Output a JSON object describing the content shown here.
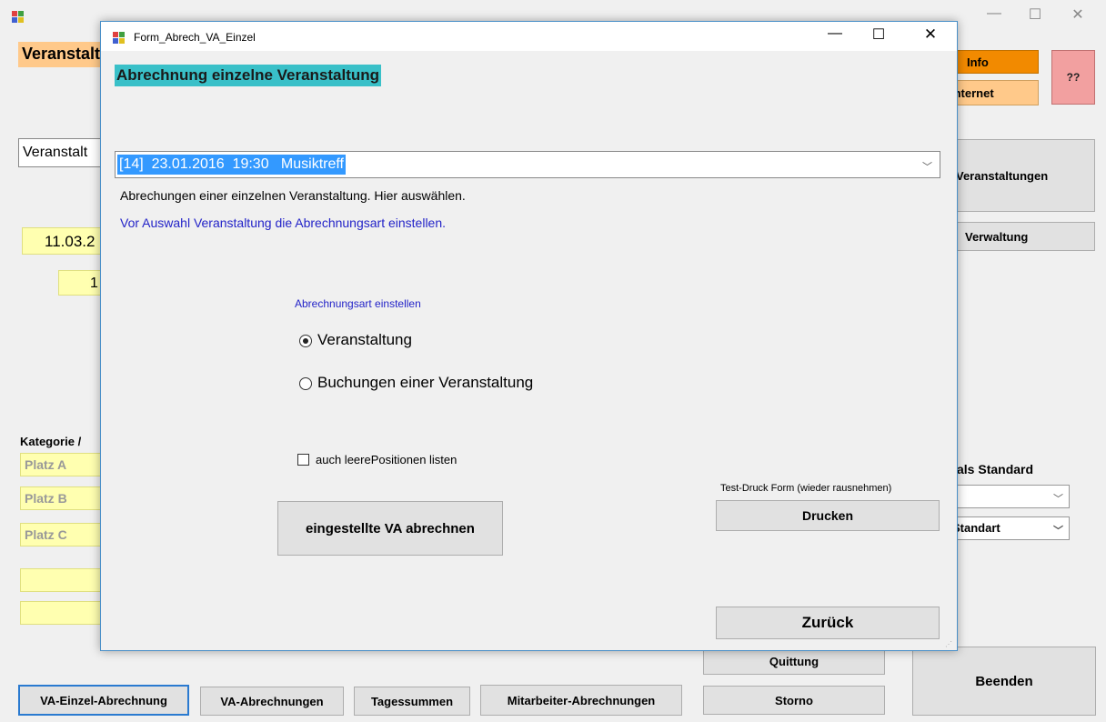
{
  "main": {
    "title_partial": "Veranstaltung",
    "combo_partial": "Veranstalt",
    "date_partial": "11.03.2",
    "time_partial": "1",
    "info_button": "Info",
    "help_button": "??",
    "internet_button": "Internet",
    "veranstaltungen_button": "Veranstaltungen",
    "verwaltung_button": "Verwaltung",
    "kategorie_label": "Kategorie /",
    "platz": [
      "Platz A",
      "Platz B",
      "Platz C"
    ],
    "als_standard_label": "als Standard",
    "standard_value": "Standart",
    "quittung_button": "Quittung",
    "storno_button": "Storno",
    "beenden_button": "Beenden",
    "tabs": [
      "VA-Einzel-Abrechnung",
      "VA-Abrechnungen",
      "Tagessummen",
      "Mitarbeiter-Abrechnungen"
    ]
  },
  "dialog": {
    "window_title": "Form_Abrech_VA_Einzel",
    "heading": "Abrechnung einzelne Veranstaltung",
    "event_select": "[14]  23.01.2016  19:30   Musiktreff",
    "hint": "Abrechungen einer einzelnen Veranstaltung. Hier auswählen.",
    "info_blue": "Vor Auswahl Veranstaltung die Abrechnungsart einstellen.",
    "group_label": "Abrechnungsart einstellen",
    "radio_options": [
      "Veranstaltung",
      "Buchungen einer Veranstaltung"
    ],
    "selected_option": "Veranstaltung",
    "checkbox_label": "auch leerePositionen listen",
    "checkbox_checked": false,
    "test_label": "Test-Druck Form (wieder rausnehmen)",
    "drucken": "Drucken",
    "abrechnen": "eingestellte VA abrechnen",
    "zurueck": "Zurück"
  },
  "colors": {
    "heading_bg": "#39c0c8",
    "selection_bg": "#3399ff",
    "info_orange": "#f28a00",
    "internet_orange": "#ffc98a",
    "help_red": "#f2a0a0",
    "title_orange": "#ffc98a",
    "yellow_field": "#ffffb0",
    "blue_text": "#2323c8",
    "dialog_border": "#4a90c8"
  }
}
